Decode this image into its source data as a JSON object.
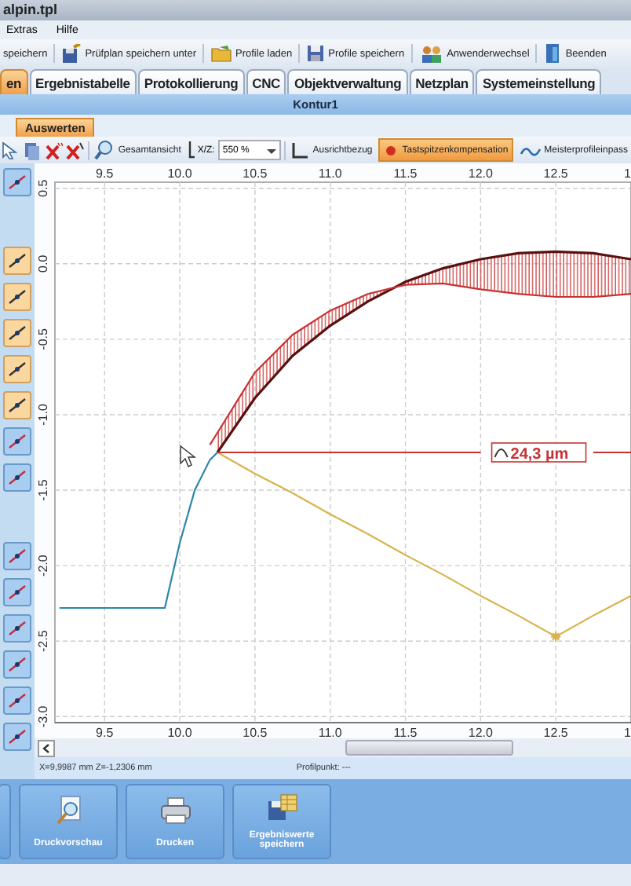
{
  "window": {
    "title": "alpin.tpl"
  },
  "menu": [
    "Extras",
    "Hilfe"
  ],
  "toolbar": [
    {
      "label": "speichern",
      "kind": "text"
    },
    {
      "label": "Prüfplan speichern unter",
      "kind": "saveas"
    },
    {
      "label": "Profile laden",
      "kind": "folder"
    },
    {
      "label": "Profile speichern",
      "kind": "disk"
    },
    {
      "label": "Anwenderwechsel",
      "kind": "users"
    },
    {
      "label": "Beenden",
      "kind": "exit"
    }
  ],
  "tabs": [
    {
      "label": "en",
      "selected": true
    },
    {
      "label": "Ergebnistabelle",
      "selected": false
    },
    {
      "label": "Protokollierung",
      "selected": false
    },
    {
      "label": "CNC",
      "selected": false
    },
    {
      "label": "Objektverwaltung",
      "selected": false
    },
    {
      "label": "Netzplan",
      "selected": false
    },
    {
      "label": "Systemeinstellung",
      "selected": false
    }
  ],
  "panel_title": "Kontur1",
  "subtabs": [
    {
      "label": "Auswerten",
      "selected": true
    }
  ],
  "chart_toolbar": {
    "zoom_fit": "Gesamtansicht",
    "scale_label": "X/Z:",
    "scale_value": "550 %",
    "align": "Ausrichtbezug",
    "tools": [
      {
        "label": "Tastspitzenkompensation",
        "selected": true
      },
      {
        "label": "Meisterprofileinpass",
        "selected": false
      }
    ]
  },
  "chart": {
    "chart_data": {
      "type": "line",
      "x": [
        9.2,
        9.5,
        9.9,
        10.0,
        10.1,
        10.2,
        10.25,
        10.5,
        10.75,
        11.0,
        11.25,
        11.5,
        11.75,
        12.0,
        12.25,
        12.5,
        12.75,
        13.0
      ],
      "series": [
        {
          "color": "#2b86a8",
          "values": [
            -2.28,
            -2.28,
            -2.28,
            -1.85,
            -1.5,
            -1.3,
            -1.25,
            null,
            null,
            null,
            null,
            null,
            null,
            null,
            null,
            null,
            null,
            null
          ]
        },
        {
          "color": "#5a1010",
          "values": [
            null,
            null,
            null,
            null,
            null,
            null,
            -1.25,
            -0.89,
            -0.61,
            -0.41,
            -0.25,
            -0.12,
            -0.03,
            0.03,
            0.07,
            0.08,
            0.07,
            0.03
          ]
        },
        {
          "color": "#c83232",
          "values": [
            null,
            null,
            null,
            null,
            null,
            -1.2,
            -1.12,
            -0.72,
            -0.47,
            -0.31,
            -0.2,
            -0.14,
            -0.13,
            -0.17,
            -0.2,
            -0.22,
            -0.22,
            -0.2
          ]
        },
        {
          "color": "#d9b24c",
          "values": [
            null,
            null,
            null,
            null,
            null,
            null,
            -1.25,
            -1.39,
            -1.52,
            -1.66,
            -1.79,
            -1.93,
            -2.06,
            -2.2,
            -2.33,
            -2.47,
            -2.33,
            -2.2
          ]
        },
        {
          "color": "#c83232",
          "values": [
            null,
            null,
            null,
            null,
            null,
            null,
            -1.25,
            -1.25,
            -1.25,
            -1.25,
            -1.25,
            -1.25,
            -1.25,
            -1.25,
            null,
            null,
            -1.25,
            -1.25
          ]
        }
      ],
      "xlim": [
        9.17,
        13.0
      ],
      "ylim": [
        -3.04,
        0.54
      ],
      "grid": true,
      "xticks": [
        9.5,
        {
          "value": 10,
          "label": "10.0"
        },
        10.5,
        {
          "value": 11,
          "label": "11.0"
        },
        11.5,
        {
          "value": 12,
          "label": "12.0"
        },
        12.5
      ],
      "yticks": [
        0.5,
        {
          "value": 0,
          "label": "0.0"
        },
        -0.5,
        {
          "value": -1,
          "label": "-1.0"
        },
        -1.5,
        {
          "value": -2,
          "label": "-2.0"
        },
        -2.5,
        {
          "value": -3,
          "label": "-3.0"
        }
      ],
      "annotations": [
        "24,3 µm"
      ]
    },
    "bottom_tick_labels": [
      "9.5",
      "10.0",
      "10.5",
      "11.0",
      "11.5",
      "12.0",
      "12.5"
    ],
    "edge_tick_labels": [
      "1",
      "1"
    ]
  },
  "status": {
    "position": "X=9,9987 mm Z=-1,2306 mm",
    "point": "Profilpunkt: ---"
  },
  "actions": [
    {
      "kind": "blank"
    },
    {
      "label": "Druckvorschau",
      "kind": "preview"
    },
    {
      "label": "Drucken",
      "kind": "print"
    },
    {
      "label": "Ergebniswerte speichern",
      "kind": "save"
    }
  ]
}
